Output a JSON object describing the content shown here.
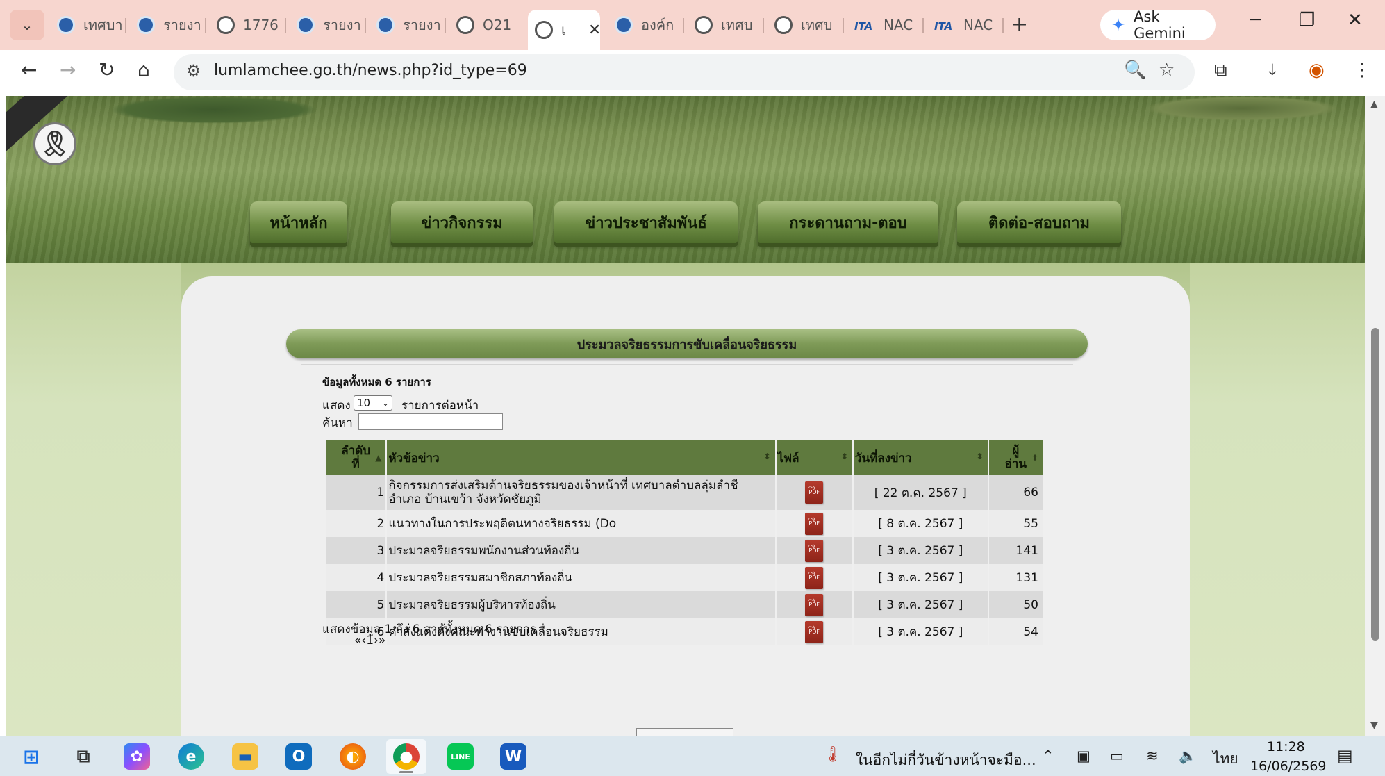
{
  "browser": {
    "tabs": [
      {
        "label": "เทศบา",
        "icon": "municipal-seal-icon"
      },
      {
        "label": "รายงา",
        "icon": "municipal-seal-icon"
      },
      {
        "label": "1776",
        "icon": "globe-icon"
      },
      {
        "label": "รายงา",
        "icon": "municipal-seal-icon"
      },
      {
        "label": "รายงา",
        "icon": "municipal-seal-icon"
      },
      {
        "label": "O21",
        "icon": "globe-icon"
      },
      {
        "label": "เ",
        "icon": "globe-icon",
        "active": true
      },
      {
        "label": "องค์ก",
        "icon": "municipal-seal-icon"
      },
      {
        "label": "เทศบ",
        "icon": "globe-icon"
      },
      {
        "label": "เทศบ",
        "icon": "globe-icon"
      },
      {
        "label": "NAC",
        "icon": "ita-icon"
      },
      {
        "label": "NAC",
        "icon": "ita-icon"
      }
    ],
    "ita_logo": "ITA",
    "new_tab": "+",
    "gemini_label": "Ask Gemini",
    "url": "lumlamchee.go.th/news.php?id_type=69"
  },
  "page": {
    "ribbon": "🎗",
    "menu": [
      "หน้าหลัก",
      "ข่าวกิจกรรม",
      "ข่าวประชาสัมพันธ์",
      "กระดานถาม-ตอบ",
      "ติดต่อ-สอบถาม"
    ],
    "section_title": "ประมวลจริยธรรมการขับเคลื่อนจริยธรรม",
    "total_label": "ข้อมูลทั้งหมด 6 รายการ",
    "show_label": "แสดง",
    "page_size": "10",
    "per_page_label": "รายการต่อหน้า",
    "search_label": "ค้นหา",
    "search_value": "",
    "columns": {
      "no_line1": "ลำดับ",
      "no_line2": "ที่",
      "title": "หัวข้อข่าว",
      "file": "ไฟล์",
      "date": "วันที่ลงข่าว",
      "views_line1": "ผู้",
      "views_line2": "อ่าน"
    },
    "rows": [
      {
        "no": "1",
        "title_line1": "กิจกรรมการส่งเสริมด้านจริยธรรมของเจ้าหน้าที่ เทศบาลตำบลลุ่มลำชี",
        "title_line2": "อำเภอ บ้านเขว้า จังหวัดชัยภูมิ",
        "date": "[ 22 ต.ค. 2567 ]",
        "views": "66"
      },
      {
        "no": "2",
        "title_line1": "แนวทางในการประพฤติตนทางจริยธรรม (Do",
        "title_line2": "",
        "date": "[ 8 ต.ค. 2567 ]",
        "views": "55"
      },
      {
        "no": "3",
        "title_line1": "ประมวลจริยธรรมพนักงานส่วนท้องถิ่น",
        "title_line2": "",
        "date": "[ 3 ต.ค. 2567 ]",
        "views": "141"
      },
      {
        "no": "4",
        "title_line1": "ประมวลจริยธรรมสมาชิกสภาท้องถิ่น",
        "title_line2": "",
        "date": "[ 3 ต.ค. 2567 ]",
        "views": "131"
      },
      {
        "no": "5",
        "title_line1": "ประมวลจริยธรรมผู้บริหารท้องถิ่น",
        "title_line2": "",
        "date": "[ 3 ต.ค. 2567 ]",
        "views": "50"
      },
      {
        "no": "6",
        "title_line1": "คำสั่งแต่งตั้งคณะทำงานขับเคลื่อนจริยธรรม",
        "title_line2": "",
        "date": "[ 3 ต.ค. 2567 ]",
        "views": "54"
      }
    ],
    "pdf_label": "PDF",
    "info_text": "แสดงข้อมูล 1 ถึง 6 จากทั้งหมด 6 รายการ",
    "pager_text": "«‹1›»"
  },
  "taskbar": {
    "weather_text": "ในอีกไม่กี่วันข้างหน้าจะมือ...",
    "language": "ไทย",
    "time": "11:28",
    "date": "16/06/2569"
  }
}
